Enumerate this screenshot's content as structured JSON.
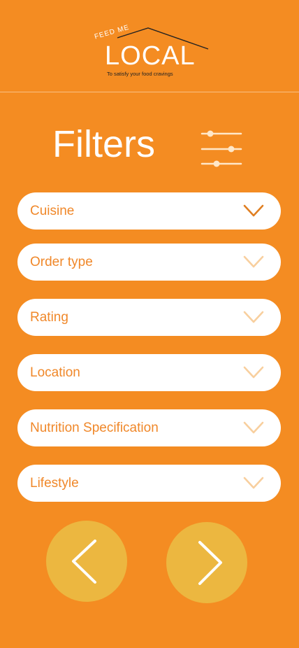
{
  "logo": {
    "feed_text": "FEED ME",
    "brand_text": "LOCAL",
    "tagline": "To satisfy your food cravings"
  },
  "page_title": "Filters",
  "filters": [
    {
      "label": "Cuisine",
      "icon": "chevron-down-icon",
      "active": true
    },
    {
      "label": "Order type",
      "icon": "chevron-down-icon",
      "active": false
    },
    {
      "label": "Rating",
      "icon": "chevron-down-icon",
      "active": false
    },
    {
      "label": "Location",
      "icon": "chevron-down-icon",
      "active": false
    },
    {
      "label": "Nutrition Specification",
      "icon": "chevron-down-icon",
      "active": false
    },
    {
      "label": "Lifestyle",
      "icon": "chevron-down-icon",
      "active": false
    }
  ],
  "icons": {
    "filter_settings": "sliders-icon",
    "previous": "chevron-left-icon",
    "next": "chevron-right-icon"
  },
  "colors": {
    "background": "#F48C22",
    "accent_text": "#F0882A",
    "chevron_active": "#E07F22",
    "chevron_inactive": "#F8CF9E",
    "nav_button": "#ECB740",
    "white": "#FFFFFF"
  }
}
